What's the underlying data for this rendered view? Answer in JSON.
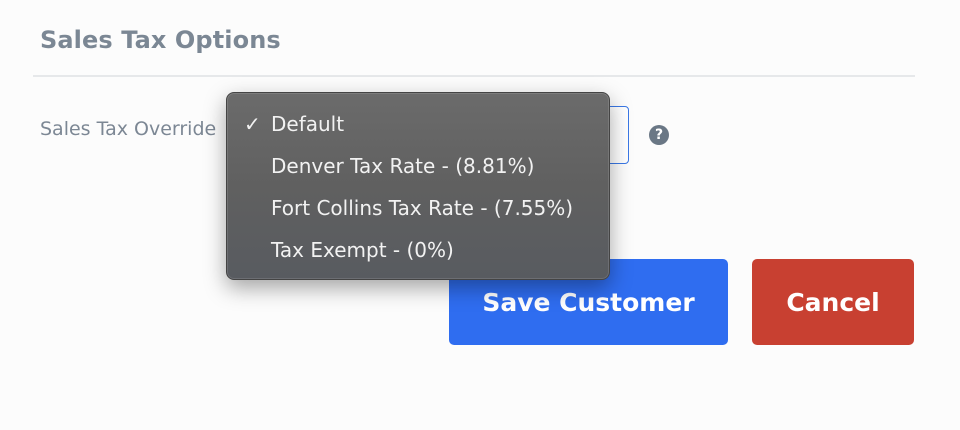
{
  "section": {
    "title": "Sales Tax Options"
  },
  "field": {
    "label": "Sales Tax Override",
    "help_icon": "question-circle-icon",
    "help_glyph": "?"
  },
  "dropdown": {
    "selected": "Default",
    "options": [
      {
        "label": "Default",
        "checked": true
      },
      {
        "label": "Denver Tax Rate - (8.81%)",
        "checked": false
      },
      {
        "label": "Fort Collins Tax Rate - (7.55%)",
        "checked": false
      },
      {
        "label": "Tax Exempt - (0%)",
        "checked": false
      }
    ],
    "check_glyph": "✓"
  },
  "buttons": {
    "save_label": "Save Customer",
    "cancel_label": "Cancel"
  },
  "colors": {
    "accent": "#2f6df0",
    "danger": "#c84031",
    "label_text": "#7c8794",
    "menu_bg": "#636363",
    "select_border": "#3a78e6"
  }
}
